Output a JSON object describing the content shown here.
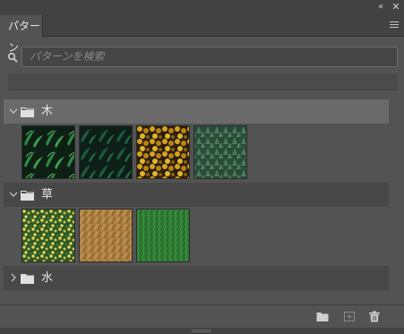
{
  "panel": {
    "tab_title": "パターン",
    "search_placeholder": "パターンを検索"
  },
  "groups": [
    {
      "name": "木",
      "expanded": true,
      "selected": true,
      "pattern_count": 4
    },
    {
      "name": "草",
      "expanded": true,
      "selected": false,
      "pattern_count": 3
    },
    {
      "name": "水",
      "expanded": false,
      "selected": false,
      "pattern_count": 0
    }
  ],
  "icons": {
    "collapse": "double-chevron-right-icon",
    "close": "close-icon",
    "menu": "hamburger-menu-icon",
    "search": "search-icon",
    "new_group": "folder-icon",
    "new_pattern": "add-icon",
    "delete": "trash-icon"
  },
  "colors": {
    "panel_bg": "#535353",
    "tabbar_bg": "#424242",
    "selected_row": "#6a6a6a",
    "group_row": "#484848"
  }
}
